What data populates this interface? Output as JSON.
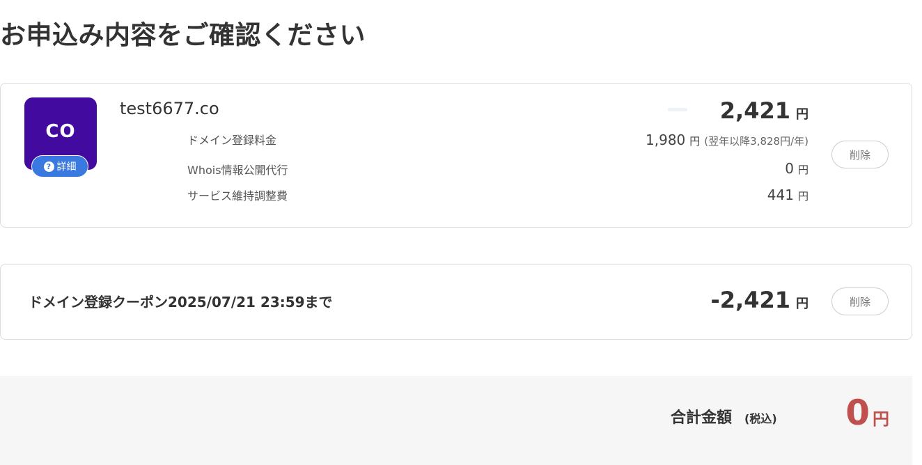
{
  "page": {
    "title": "お申込み内容をご確認ください"
  },
  "domain_item": {
    "tld_logo": "CO",
    "detail_label": "詳細",
    "domain_name": "test6677.co",
    "total": "2,421",
    "currency": "円",
    "fees": [
      {
        "label": "ドメイン登録料金",
        "amount": "1,980",
        "currency": "円",
        "note": "(翌年以降3,828円/年)"
      },
      {
        "label": "Whois情報公開代行",
        "amount": "0",
        "currency": "円",
        "note": ""
      },
      {
        "label": "サービス維持調整費",
        "amount": "441",
        "currency": "円",
        "note": ""
      }
    ],
    "delete_label": "削除"
  },
  "coupon": {
    "label": "ドメイン登録クーポン2025/07/21 23:59まで",
    "amount": "-2,421",
    "currency": "円",
    "delete_label": "削除"
  },
  "total": {
    "label": "合計金額",
    "tax_note": "(税込)",
    "amount": "0",
    "currency": "円",
    "color": "#c0504d"
  },
  "colors": {
    "tld_logo_bg": "#430aa0",
    "detail_badge_bg": "#3a7ae0"
  }
}
